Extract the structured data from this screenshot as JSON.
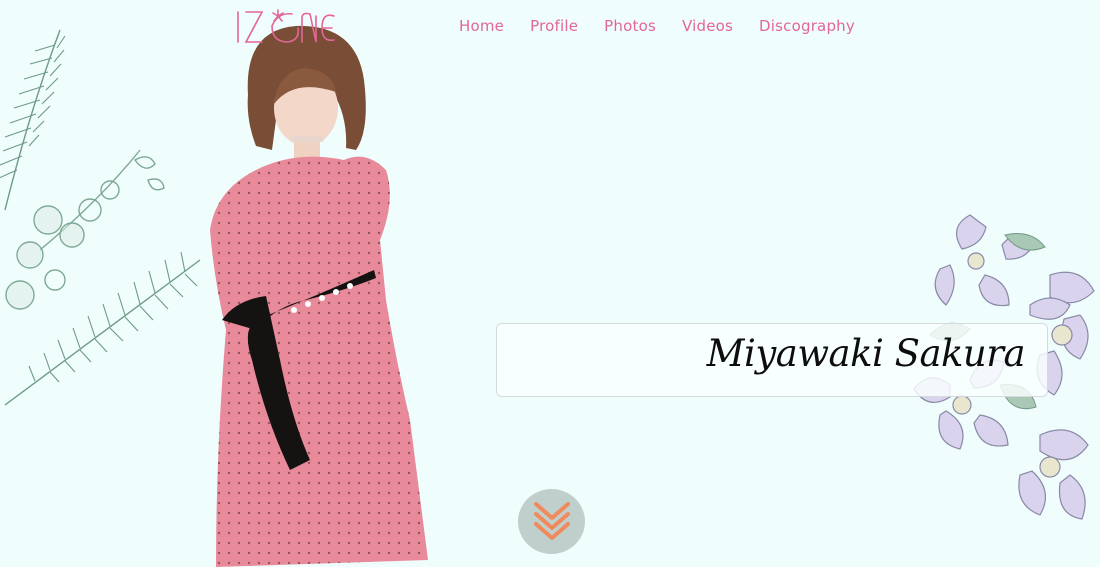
{
  "brand": {
    "logo_text": "IZ*ONE",
    "accent_color": "#e2669a"
  },
  "nav": {
    "items": [
      {
        "label": "Home"
      },
      {
        "label": "Profile"
      },
      {
        "label": "Photos"
      },
      {
        "label": "Videos"
      },
      {
        "label": "Discography"
      }
    ]
  },
  "hero": {
    "member_name": "Miyawaki Sakura",
    "scroll_icon": "double-chevron-down-icon",
    "scroll_color": "#f08a5d"
  }
}
